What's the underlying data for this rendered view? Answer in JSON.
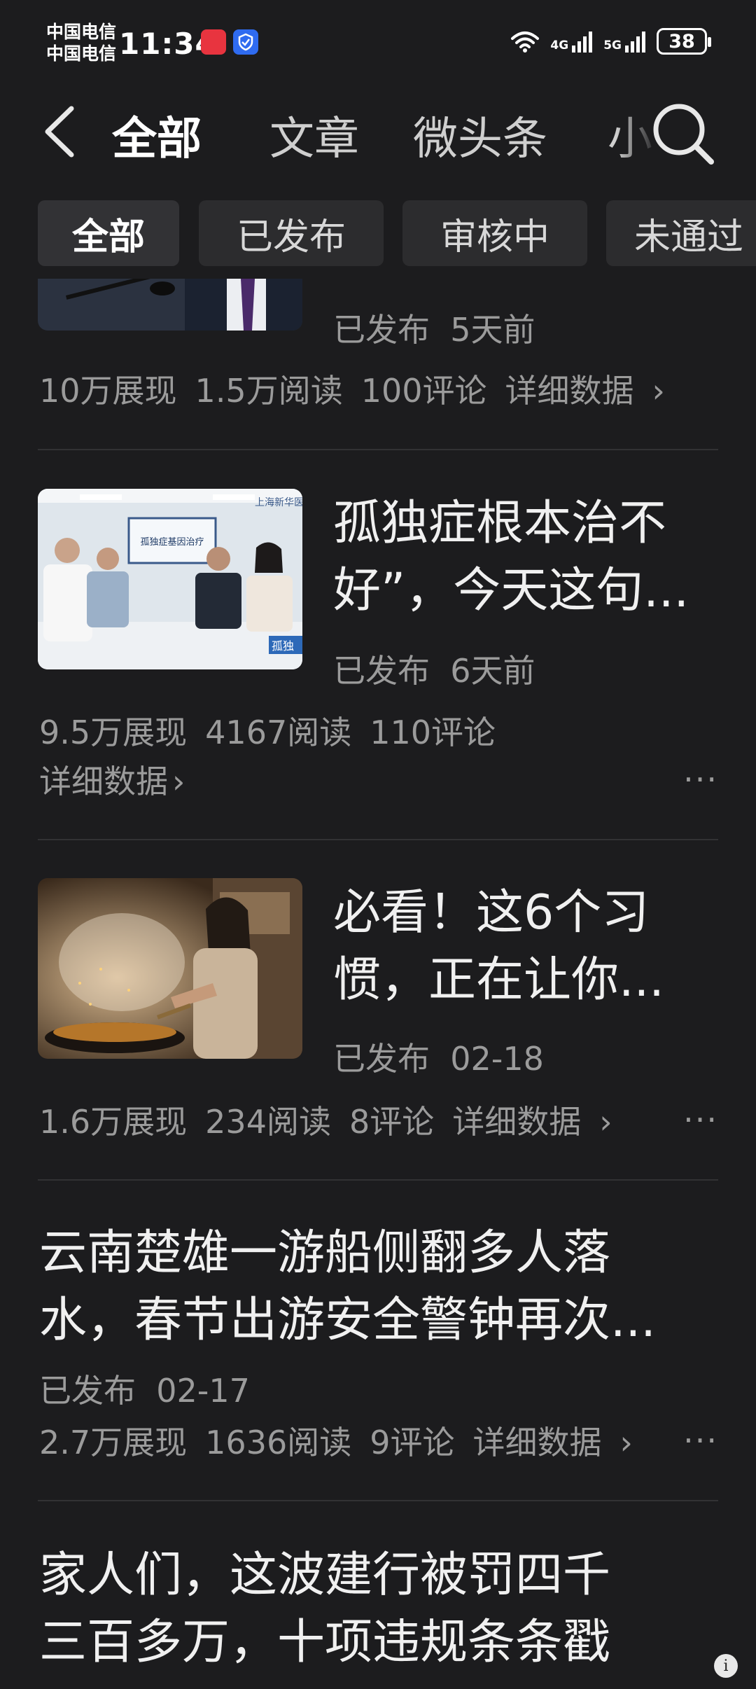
{
  "status_bar": {
    "carrier_1": "中国电信",
    "carrier_2": "中国电信",
    "time": "11:34",
    "network_1": "4G",
    "network_2": "5G",
    "battery": "38"
  },
  "nav": {
    "tabs": [
      {
        "label": "全部",
        "active": true
      },
      {
        "label": "文章",
        "active": false
      },
      {
        "label": "微头条",
        "active": false
      },
      {
        "label": "小",
        "active": false
      }
    ],
    "icons": {
      "back": "back-chevron-icon",
      "search": "search-icon"
    }
  },
  "filters": [
    {
      "label": "全部",
      "active": true
    },
    {
      "label": "已发布",
      "active": false
    },
    {
      "label": "审核中",
      "active": false
    },
    {
      "label": "未通过",
      "active": false
    }
  ],
  "articles": [
    {
      "title_lines": [],
      "status": "已发布",
      "time": "5天前",
      "impressions": "10万展现",
      "reads": "1.5万阅读",
      "comments": "100评论",
      "details": "详细数据",
      "has_more": false
    },
    {
      "thumb_caption": "孤独症基因治疗",
      "thumb_corner_text": "上海新华医",
      "thumb_tag": "孤独",
      "title_lines": [
        "孤独症根本治不",
        "好”，今天这句..."
      ],
      "status": "已发布",
      "time": "6天前",
      "impressions": "9.5万展现",
      "reads": "4167阅读",
      "comments": "110评论",
      "details": "详细数据",
      "has_more": true,
      "more": "···"
    },
    {
      "title_lines": [
        "必看！这6个习",
        "惯，正在让你..."
      ],
      "status": "已发布",
      "time": "02-18",
      "impressions": "1.6万展现",
      "reads": "234阅读",
      "comments": "8评论",
      "details": "详细数据",
      "has_more": true,
      "more": "···"
    },
    {
      "title_lines": [
        "云南楚雄一游船侧翻多人落",
        "水，春节出游安全警钟再次..."
      ],
      "status": "已发布",
      "time": "02-17",
      "impressions": "2.7万展现",
      "reads": "1636阅读",
      "comments": "9评论",
      "details": "详细数据",
      "has_more": true,
      "more": "···"
    },
    {
      "title_lines": [
        "家人们，这波建行被罚四千",
        "三百多万，十项违规条条戳"
      ]
    }
  ],
  "colors": {
    "background": "#1c1c1e",
    "chip_bg": "#2c2c2e",
    "muted_text": "#9b9b9b",
    "title_text": "#f0f0f0",
    "divider": "#323234"
  }
}
